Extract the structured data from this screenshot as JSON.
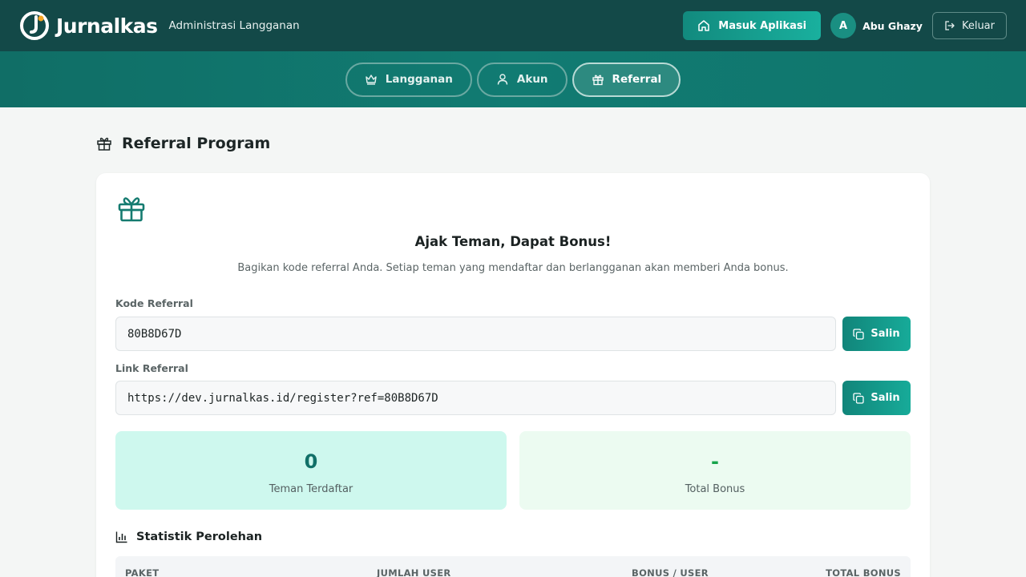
{
  "header": {
    "brand_name": "Jurnalkas",
    "brand_subtitle": "Administrasi Langganan",
    "enter_app_label": "Masuk Aplikasi",
    "user_initial": "A",
    "user_name": "Abu Ghazy",
    "logout_label": "Keluar"
  },
  "tabs": [
    {
      "label": "Langganan",
      "icon": "crown-icon",
      "active": false
    },
    {
      "label": "Akun",
      "icon": "user-icon",
      "active": false
    },
    {
      "label": "Referral",
      "icon": "gift-icon",
      "active": true
    }
  ],
  "page": {
    "title": "Referral Program"
  },
  "referral": {
    "heading": "Ajak Teman, Dapat Bonus!",
    "description": "Bagikan kode referral Anda. Setiap teman yang mendaftar dan berlangganan akan memberi Anda bonus.",
    "code_label": "Kode Referral",
    "code_value": "80B8D67D",
    "link_label": "Link Referral",
    "link_value": "https://dev.jurnalkas.id/register?ref=80B8D67D",
    "copy_label": "Salin"
  },
  "stats": {
    "registered_value": "0",
    "registered_label": "Teman Terdaftar",
    "bonus_value": "-",
    "bonus_label": "Total Bonus"
  },
  "earnings": {
    "title": "Statistik Perolehan",
    "columns": [
      "PAKET",
      "JUMLAH USER",
      "BONUS / USER",
      "TOTAL BONUS"
    ]
  },
  "colors": {
    "topbar": "#134948",
    "accent": "#17a896",
    "tabbar": "#117b72"
  }
}
